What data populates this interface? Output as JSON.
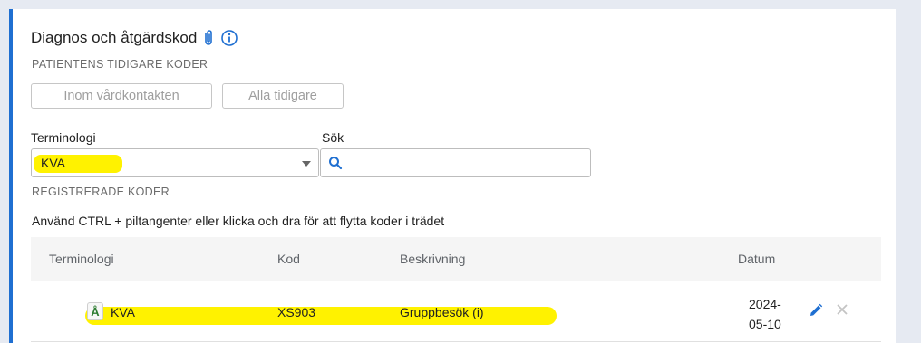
{
  "section": {
    "title": "Diagnos och åtgärdskod",
    "subtitle": "PATIENTENS TIDIGARE KODER"
  },
  "filters": {
    "within_contact_label": "Inom vårdkontakten",
    "all_previous_label": "Alla tidigare",
    "terminology_label": "Terminologi",
    "terminology_value": "KVA",
    "search_label": "Sök",
    "search_value": ""
  },
  "registered": {
    "heading": "REGISTRERADE KODER",
    "hint": "Använd CTRL + piltangenter eller klicka och dra för att flytta koder i trädet"
  },
  "table": {
    "columns": [
      "Terminologi",
      "Kod",
      "Beskrivning",
      "Datum"
    ],
    "rows": [
      {
        "badge": "Å",
        "terminology": "KVA",
        "code": "XS903",
        "description": "Gruppbesök (i)",
        "date_line1": "2024-",
        "date_line2": "05-10"
      }
    ]
  },
  "colors": {
    "accent": "#1f6fd1",
    "highlight": "#fff200",
    "badge_text": "#2e7d32"
  },
  "icons": [
    "paperclip-icon",
    "info-icon",
    "search-icon",
    "chevron-down-icon",
    "edit-icon",
    "close-icon"
  ]
}
